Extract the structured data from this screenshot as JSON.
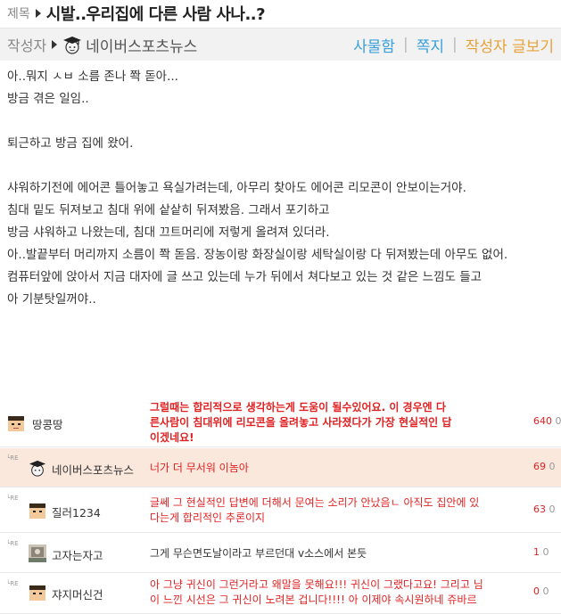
{
  "post": {
    "title_label": "제목",
    "title": "시발..우리집에 다른 사람 사나..?",
    "author_label": "작성자",
    "author": "네이버스포츠뉴스",
    "links": [
      "사물함",
      "쪽지",
      "작성자 글보기"
    ]
  },
  "body_lines": [
    "아..뭐지 ㅅㅂ 소름 존나 쫙 돋아...",
    "방금 겪은 일임..",
    "",
    "퇴근하고 방금 집에 왔어.",
    "",
    "샤워하기전에 에어콘 틀어놓고 욕실가려는데, 아무리 찾아도 에어콘 리모콘이 안보이는거야.",
    "침대 밑도 뒤져보고 침대 위에 샅샅히 뒤져봤음. 그래서 포기하고",
    "방금 샤워하고 나왔는데, 침대 끄트머리에 저렇게 올려져 있더라.",
    "아..발끝부터 머리까지 소름이 쫙 돋음. 장농이랑 화장실이랑 세탁실이랑 다 뒤져봤는데 아무도 없어.",
    "컴퓨터앞에 앉아서 지금 대자에 글 쓰고 있는데 누가 뒤에서 쳐다보고 있는 것 같은 느낌도 들고",
    "아 기분탓일꺼야.."
  ],
  "comments": [
    {
      "reply": false,
      "nick": "땅콩땅",
      "text": [
        "그럴때는 합리적으로 생각하는게 도움이 될수있어요. 이 경우엔 다",
        "른사람이 침대위에 리모콘을 올려놓고 사라졌다가 가장 현실적인 답",
        "이겠네요!"
      ],
      "n1": "640",
      "n2": "0"
    },
    {
      "reply": true,
      "re": "└RE",
      "nick": "네이버스포츠뉴스",
      "text": [
        "너가 더 무서워 이놈아"
      ],
      "n1": "69",
      "n2": "0"
    },
    {
      "reply": true,
      "re": "└RE",
      "nick": "질러1234",
      "text": [
        "글쎄 그 현실적인 답변에 더해서 문여는 소리가 안났음ㄴ 아직도 집안에 있",
        "다는게 합리적인 추론이지"
      ],
      "n1": "63",
      "n2": "0"
    },
    {
      "reply": true,
      "re": "└RE",
      "nick": "고자는자고",
      "text": [
        "그게 무슨면도날이라고 부르던대 v소스에서 본듯"
      ],
      "n1": "1",
      "n2": "0"
    },
    {
      "reply": true,
      "re": "└RE",
      "nick": "쟈지머신건",
      "text": [
        "아 그냥 귀신이 그런거라고 왜말을 못해요!!! 귀신이 그랬다고요! 그리고 님",
        "이 느낀 시선은 그 귀신이 노려본 겁니다!!!! 아 이제야 속시원하네 쥬바르"
      ],
      "n1": "0",
      "n2": "0"
    }
  ],
  "colors": {
    "link_blue": "#3aa0d8",
    "link_orange": "#e8a23a",
    "comment_red": "#e02222",
    "highlight_row": "#fbe8dd"
  },
  "icons": {
    "title_arrow": "triangle-right-icon",
    "author_avatar": "graduation-cap-avatar-icon",
    "user_avatar": "pixel-face-avatar-icon",
    "photo_avatar": "photo-avatar-icon"
  }
}
